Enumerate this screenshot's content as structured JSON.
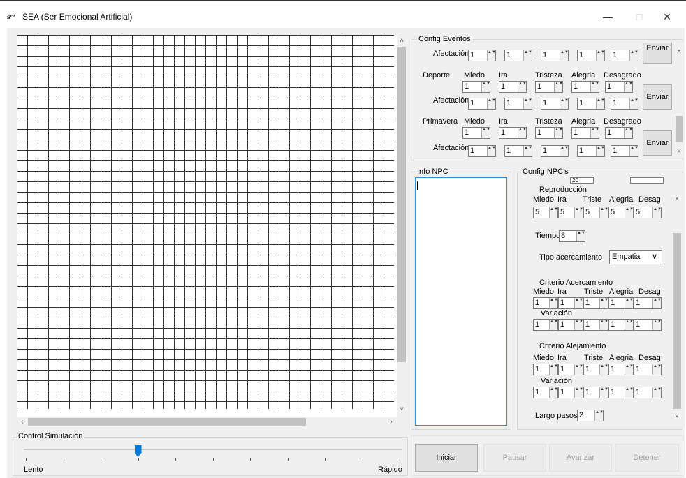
{
  "window": {
    "logo": "sᴱᴬ",
    "title": "SEA (Ser Emocional Artificial)",
    "minimize": "—",
    "maximize": "□",
    "close": "✕"
  },
  "config_eventos": {
    "legend": "Config Eventos",
    "affect_label": "Afectación",
    "send_label": "Enviar",
    "top_partial_row": [
      "1",
      "1",
      "1",
      "1",
      "1"
    ],
    "events": [
      {
        "name": "Deporte",
        "headers": [
          "Miedo",
          "Ira",
          "Tristeza",
          "Alegria",
          "Desagrado"
        ],
        "values": [
          "1",
          "1",
          "1",
          "1",
          "1"
        ],
        "affect": [
          "1",
          "1",
          "1",
          "1",
          "1"
        ]
      },
      {
        "name": "Primavera",
        "headers": [
          "Miedo",
          "Ira",
          "Tristeza",
          "Alegria",
          "Desagrado"
        ],
        "values": [
          "1",
          "1",
          "1",
          "1",
          "1"
        ],
        "affect": [
          "1",
          "1",
          "1",
          "1",
          "1"
        ]
      }
    ]
  },
  "info_npc": {
    "legend": "Info NPC",
    "text": ""
  },
  "config_npcs": {
    "legend": "Config NPC's",
    "partial_top": [
      "20",
      ""
    ],
    "reproduccion": {
      "title": "Reproducción",
      "headers": [
        "Miedo",
        "Ira",
        "Triste",
        "Alegria",
        "Desag"
      ],
      "values": [
        "5",
        "5",
        "5",
        "5",
        "5"
      ]
    },
    "tiempo": {
      "label": "Tiempo",
      "value": "8"
    },
    "tipo": {
      "label": "Tipo acercamiento",
      "value": "Empatia",
      "arrow": "∨"
    },
    "acercamiento": {
      "title": "Criterio Acercamiento",
      "headers": [
        "Miedo",
        "Ira",
        "Triste",
        "Alegria",
        "Desag"
      ],
      "values": [
        "1",
        "1",
        "1",
        "1",
        "1"
      ],
      "variation_label": "Variación",
      "variation": [
        "1",
        "1",
        "1",
        "1",
        "1"
      ]
    },
    "alejamiento": {
      "title": "Criterio Alejamiento",
      "headers": [
        "Miedo",
        "Ira",
        "Triste",
        "Alegria",
        "Desag"
      ],
      "values": [
        "1",
        "1",
        "1",
        "1",
        "1"
      ],
      "variation_label": "Variación",
      "variation": [
        "1",
        "1",
        "1",
        "1",
        "1"
      ]
    },
    "largo": {
      "label": "Largo pasos",
      "value": "2"
    }
  },
  "control": {
    "legend": "Control Simulación",
    "slow": "Lento",
    "fast": "Rápido",
    "speed_fraction": 0.3
  },
  "buttons": {
    "start": "Iniciar",
    "pause": "Pausar",
    "step": "Avanzar",
    "stop": "Detener"
  },
  "arrows": {
    "up": "˄",
    "down": "˅",
    "left": "‹",
    "right": "›",
    "spin": "▲▼"
  }
}
